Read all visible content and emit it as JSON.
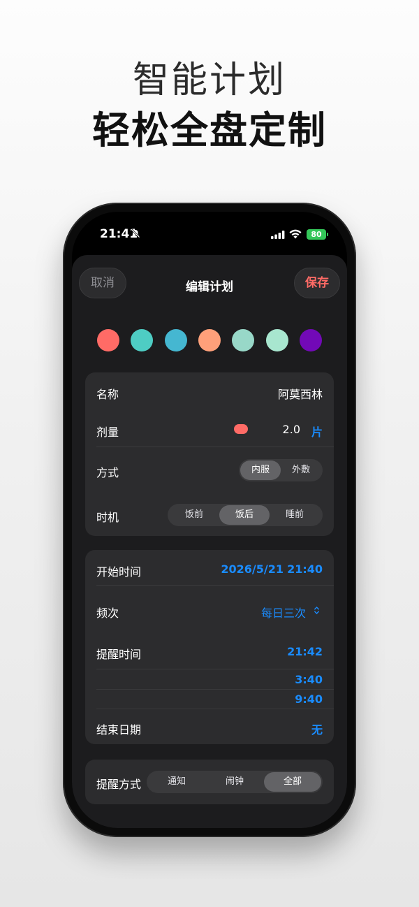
{
  "headline": {
    "line1": "智能计划",
    "line2": "轻松全盘定制"
  },
  "status_bar": {
    "time": "21:41",
    "battery": "80"
  },
  "nav": {
    "cancel": "取消",
    "title": "编辑计划",
    "save": "保存"
  },
  "colors": {
    "accent": "#1a8cff",
    "save": "#ff6b66",
    "swatches": [
      "#ff6b66",
      "#4ecdc4",
      "#45b7d1",
      "#ffa07a",
      "#98d8c8",
      "#a8e6cf",
      "#7209b7"
    ]
  },
  "plan": {
    "name_label": "名称",
    "name_value": "阿莫西林",
    "dose_label": "剂量",
    "dose_value": "2.0",
    "dose_unit": "片",
    "method_label": "方式",
    "method_options": [
      "内服",
      "外敷"
    ],
    "method_selected": "内服",
    "timing_label": "时机",
    "timing_options": [
      "饭前",
      "饭后",
      "睡前"
    ],
    "timing_selected": "饭后"
  },
  "schedule": {
    "start_label": "开始时间",
    "start_date": "2026/5/21",
    "start_time": "21:40",
    "frequency_label": "频次",
    "frequency_value": "每日三次",
    "reminder_label": "提醒时间",
    "reminder_times": [
      "21:42",
      "3:40",
      "9:40"
    ],
    "end_label": "结束日期",
    "end_value": "无"
  },
  "reminder_mode": {
    "label": "提醒方式",
    "options": [
      "通知",
      "闹钟",
      "全部"
    ],
    "selected": "全部"
  }
}
